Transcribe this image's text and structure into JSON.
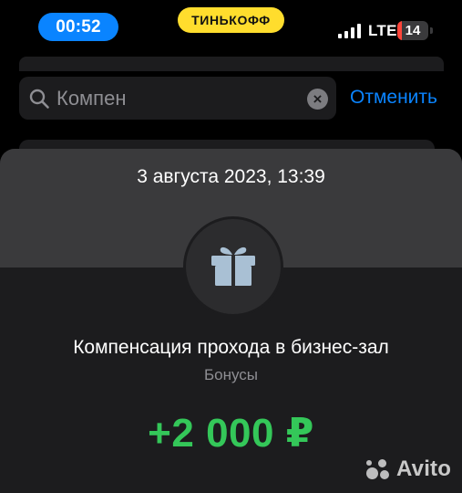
{
  "status_bar": {
    "time": "00:52",
    "brand": "ТИНЬКОФФ",
    "network": "LTE",
    "battery": "14",
    "battery_level": 0.14
  },
  "search": {
    "query": "Компен",
    "cancel_label": "Отменить"
  },
  "sheet": {
    "date": "3 августа 2023, 13:39",
    "icon": "gift-icon",
    "title": "Компенсация прохода в бизнес-зал",
    "category": "Бонусы",
    "amount": "+2 000 ₽"
  },
  "watermark": {
    "text": "Avito"
  },
  "colors": {
    "accent_blue": "#0a84ff",
    "brand_yellow": "#ffdd2d",
    "amount_green": "#34c759",
    "battery_low": "#ff453a"
  }
}
